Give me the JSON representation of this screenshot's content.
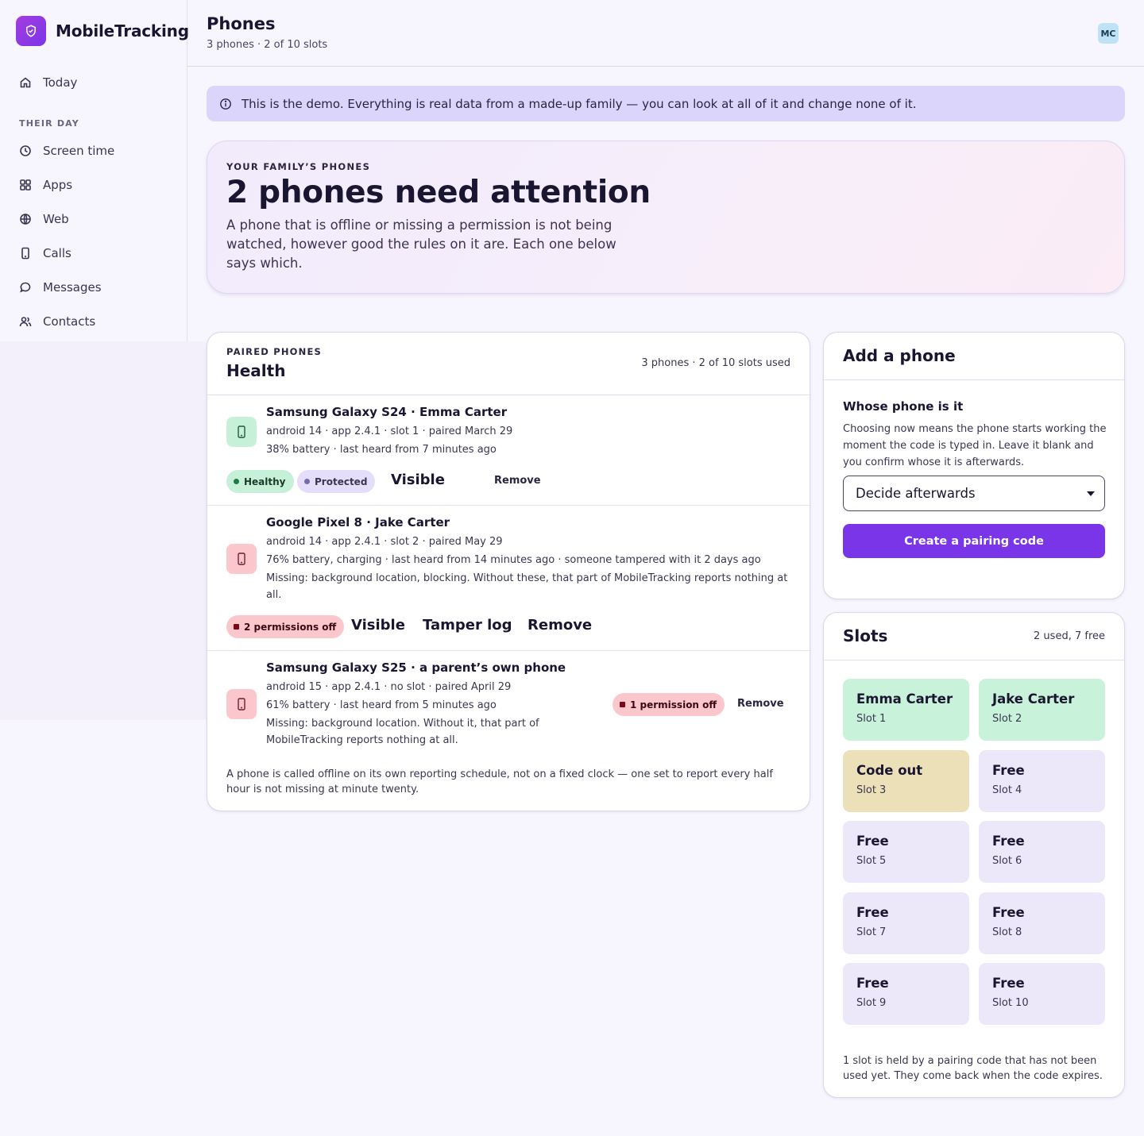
{
  "app": {
    "name": "MobileTracking"
  },
  "nav": {
    "today": "Today",
    "section": "THEIR DAY",
    "items": [
      {
        "label": "Screen time",
        "icon": "clock-icon"
      },
      {
        "label": "Apps",
        "icon": "grid-icon"
      },
      {
        "label": "Web",
        "icon": "globe-icon"
      },
      {
        "label": "Calls",
        "icon": "phone-icon"
      },
      {
        "label": "Messages",
        "icon": "message-icon"
      },
      {
        "label": "Contacts",
        "icon": "users-icon"
      }
    ]
  },
  "header": {
    "title": "Phones",
    "subtitle": "3 phones · 2 of 10 slots",
    "avatar": "MC"
  },
  "banner": {
    "text": "This is the demo. Everything is real data from a made-up family — you can look at all of it and change none of it."
  },
  "hero": {
    "kicker": "YOUR FAMILY’S PHONES",
    "title": "2 phones need attention",
    "description": "A phone that is offline or missing a permission is not being watched, however good the rules on it are. Each one below says which."
  },
  "health": {
    "kicker": "PAIRED PHONES",
    "title": "Health",
    "count": "3 phones · 2 of 10 slots used",
    "phones": [
      {
        "name": "Samsung Galaxy S24 · Emma Carter",
        "line1": "android 14 · app 2.4.1 · slot 1 · paired March 29",
        "line2": "38% battery · last heard from 7 minutes ago",
        "badges": [
          "Healthy",
          "Protected"
        ],
        "actions": [
          "Visible",
          "Remove"
        ]
      },
      {
        "name": "Google Pixel 8 · Jake Carter",
        "line1": "android 14 · app 2.4.1 · slot 2 · paired May 29",
        "line2": "76% battery, charging · last heard from 14 minutes ago · someone tampered with it 2 days ago",
        "line3": "Missing: background location, blocking. Without these, that part of MobileTracking reports nothing at all.",
        "badges": [
          "2 permissions off"
        ],
        "actions": [
          "Visible",
          "Tamper log",
          "Remove"
        ]
      },
      {
        "name": "Samsung Galaxy S25 · a parent’s own phone",
        "line1": "android 15 · app 2.4.1 · no slot · paired April 29",
        "line2": "61% battery · last heard from 5 minutes ago",
        "line3": "Missing: background location. Without it, that part of MobileTracking reports nothing at all.",
        "badges": [
          "1 permission off"
        ],
        "actions": [
          "Remove"
        ]
      }
    ],
    "footnote": "A phone is called offline on its own reporting schedule, not on a fixed clock — one set to report every half hour is not missing at minute twenty."
  },
  "add_phone": {
    "title": "Add a phone",
    "label": "Whose phone is it",
    "help": "Choosing now means the phone starts working the moment the code is typed in. Leave it blank and you confirm whose it is afterwards.",
    "select_value": "Decide afterwards",
    "button": "Create a pairing code"
  },
  "slots": {
    "title": "Slots",
    "count": "2 used, 7 free",
    "items": [
      {
        "name": "Emma Carter",
        "slot": "Slot 1",
        "state": "used"
      },
      {
        "name": "Jake Carter",
        "slot": "Slot 2",
        "state": "used"
      },
      {
        "name": "Code out",
        "slot": "Slot 3",
        "state": "code"
      },
      {
        "name": "Free",
        "slot": "Slot 4",
        "state": "free"
      },
      {
        "name": "Free",
        "slot": "Slot 5",
        "state": "free"
      },
      {
        "name": "Free",
        "slot": "Slot 6",
        "state": "free"
      },
      {
        "name": "Free",
        "slot": "Slot 7",
        "state": "free"
      },
      {
        "name": "Free",
        "slot": "Slot 8",
        "state": "free"
      },
      {
        "name": "Free",
        "slot": "Slot 9",
        "state": "free"
      },
      {
        "name": "Free",
        "slot": "Slot 10",
        "state": "free"
      }
    ],
    "note": "1 slot is held by a pairing code that has not been used yet. They come back when the code expires."
  },
  "colors": {
    "accent": "#7a35e8",
    "healthy": "#c7f0d8",
    "warning": "#fbc7cd",
    "code": "#ebe0b8",
    "free": "#ece8f9"
  }
}
